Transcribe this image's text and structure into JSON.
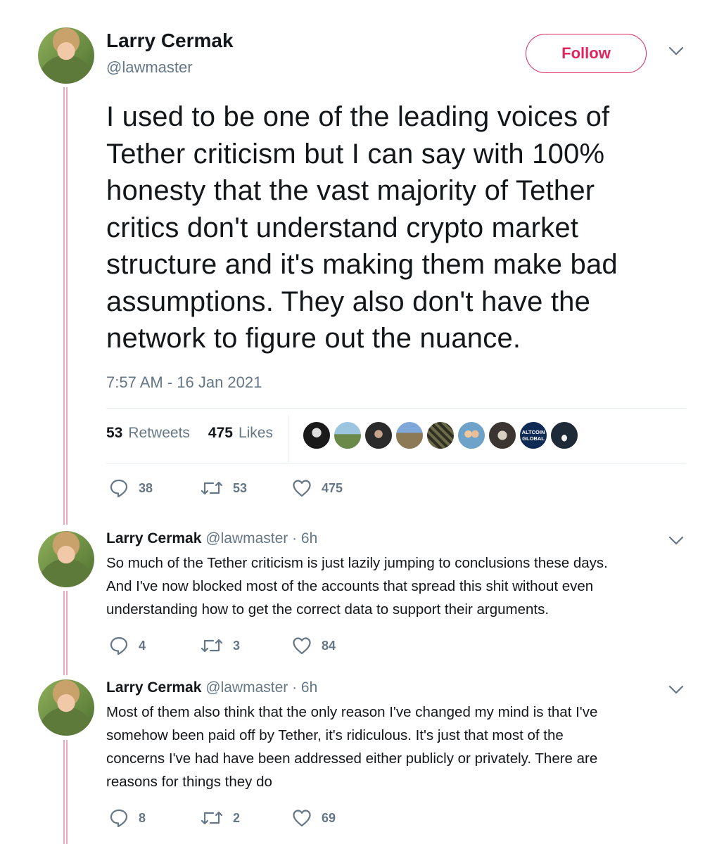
{
  "main_tweet": {
    "author_name": "Larry Cermak",
    "author_handle": "@lawmaster",
    "follow_label": "Follow",
    "text_lines": [
      "I used to be one of the leading voices of",
      "Tether criticism but I can say with 100%",
      "honesty that the vast majority of Tether",
      "critics don't understand crypto market",
      "structure and it's making them make bad",
      "assumptions. They also don't have the",
      "network to figure out the nuance."
    ],
    "timestamp": "7:57 AM - 16 Jan 2021",
    "retweets_count": "53",
    "retweets_label": "Retweets",
    "likes_count": "475",
    "likes_label": "Likes",
    "liker_badge_text": "ALTCOIN GLOBAL",
    "actions": {
      "replies": "38",
      "retweets": "53",
      "likes": "475"
    }
  },
  "replies": [
    {
      "author_name": "Larry Cermak",
      "meta": "@lawmaster · 6h",
      "text_lines": [
        "So much of the Tether criticism is just lazily jumping to conclusions these days.",
        "And I've now blocked most of the accounts that spread this shit without even",
        "understanding how to get the correct data to support their arguments."
      ],
      "actions": {
        "replies": "4",
        "retweets": "3",
        "likes": "84"
      }
    },
    {
      "author_name": "Larry Cermak",
      "meta": "@lawmaster · 6h",
      "text_lines": [
        "Most of them also think that the only reason I've changed my mind is that I've",
        "somehow been paid off by Tether, it's ridiculous. It's just that most of the",
        "concerns I've had have been addressed either publicly or privately. There are",
        "reasons for things they do"
      ],
      "actions": {
        "replies": "8",
        "retweets": "2",
        "likes": "69"
      }
    }
  ],
  "colors": {
    "accent": "#e0245e",
    "muted": "#657786",
    "thread_line": "#e6a9bd"
  },
  "icons": [
    "reply-icon",
    "retweet-icon",
    "heart-icon",
    "chevron-down-icon"
  ]
}
